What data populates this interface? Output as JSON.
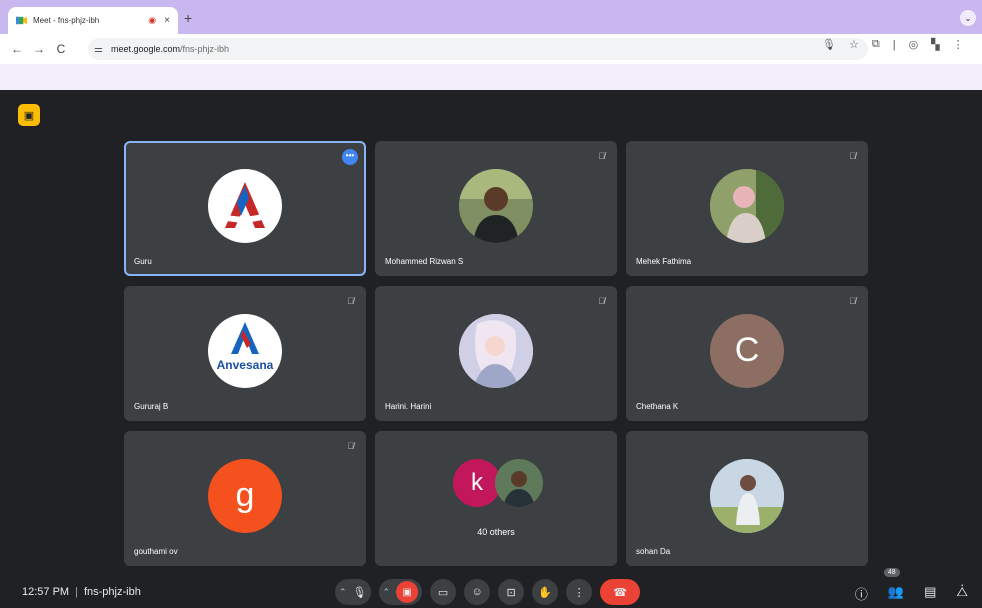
{
  "browser": {
    "tab_title": "Meet - fns-phjz-ibh",
    "tab_close": "×",
    "new_tab": "+",
    "tab_menu": "⌄",
    "url_host": "meet.google.com",
    "url_path": "/fns-phjz-ibh",
    "back": "←",
    "forward": "→",
    "reload": "C"
  },
  "tiles": [
    {
      "name": "Guru"
    },
    {
      "name": "Mohammed Rizwan S"
    },
    {
      "name": "Mehek Fathima"
    },
    {
      "name": "Gururaj B",
      "logo_text": "Anvesana"
    },
    {
      "name": "Harini. Harini"
    },
    {
      "name": "Chethana K",
      "initial": "C",
      "color": "#8d6e63"
    },
    {
      "name": "gouthami ov",
      "initial": "g",
      "color": "#f4511e"
    },
    {
      "others_initial": "k",
      "others_label": "40 others"
    },
    {
      "name": "sohan Da"
    }
  ],
  "bottom": {
    "time": "12:57 PM",
    "separator": "|",
    "meeting_code": "fns-phjz-ibh",
    "participant_count": "48"
  },
  "colors": {
    "accent": "#8ab4f8",
    "end_call": "#ea4335",
    "background": "#202124",
    "tile": "#3c4043"
  }
}
